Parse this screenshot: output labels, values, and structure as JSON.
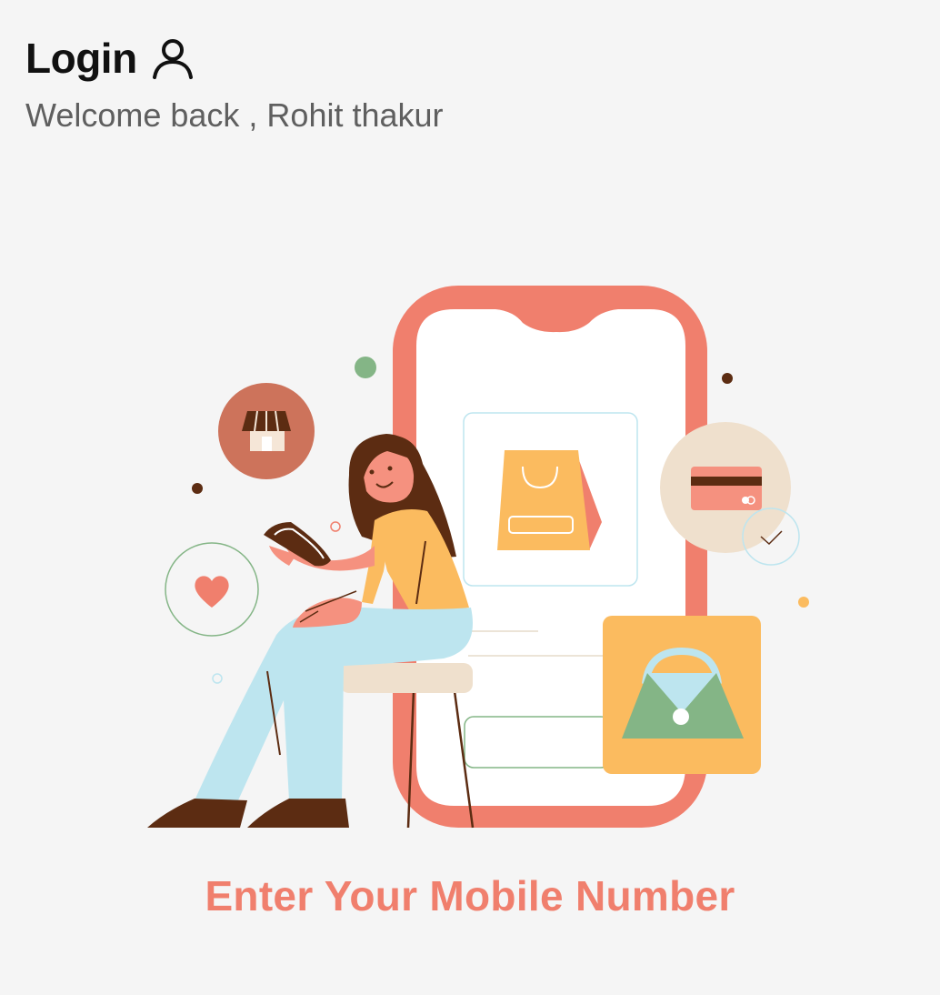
{
  "header": {
    "title": "Login",
    "subtitle": "Welcome back , Rohit thakur",
    "title_icon": "user-icon"
  },
  "illustration": {
    "name": "woman-shopping-on-phone-illustration",
    "icons": [
      "store-icon",
      "heart-icon",
      "credit-card-icon",
      "check-icon",
      "shopping-bag-icon",
      "handbag-icon"
    ],
    "colors": {
      "phone_frame": "#f07f6d",
      "accent_yellow": "#fbbb5f",
      "accent_green": "#84b586",
      "accent_blue": "#bde5ef",
      "hair_brown": "#5c2c12",
      "skin": "#f5917f"
    }
  },
  "cta": {
    "label": "Enter Your Mobile Number"
  },
  "colors": {
    "background": "#f5f5f5",
    "title": "#111111",
    "subtitle": "#5f5f5f",
    "accent": "#f07f6d"
  }
}
